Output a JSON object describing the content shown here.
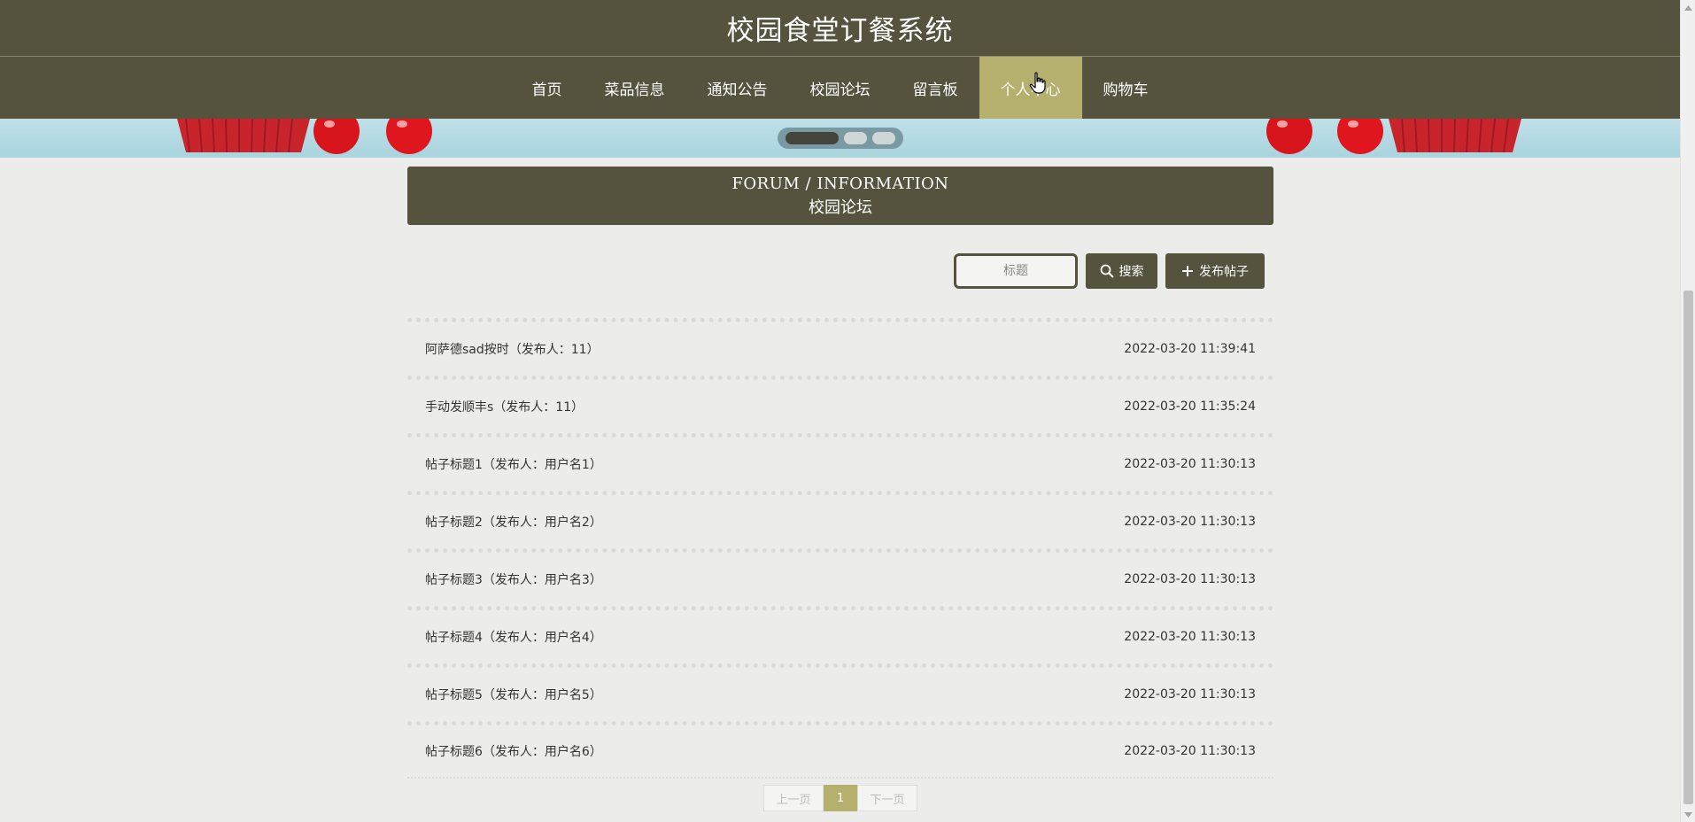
{
  "header": {
    "site_title": "校园食堂订餐系统"
  },
  "nav": {
    "items": [
      {
        "label": "首页"
      },
      {
        "label": "菜品信息"
      },
      {
        "label": "通知公告"
      },
      {
        "label": "校园论坛"
      },
      {
        "label": "留言板"
      },
      {
        "label": "个人中心",
        "active": true
      },
      {
        "label": "购物车"
      }
    ]
  },
  "banner": {
    "slides": 3,
    "active_slide": 1
  },
  "section": {
    "title_en": "FORUM / INFORMATION",
    "title_cn": "校园论坛"
  },
  "toolbar": {
    "search_placeholder": "标题",
    "search_label": "搜索",
    "publish_label": "发布帖子"
  },
  "forum": {
    "rows": [
      {
        "title": "阿萨德sad按时（发布人：11）",
        "time": "2022-03-20 11:39:41"
      },
      {
        "title": "手动发顺丰s（发布人：11）",
        "time": "2022-03-20 11:35:24"
      },
      {
        "title": "帖子标题1（发布人：用户名1）",
        "time": "2022-03-20 11:30:13"
      },
      {
        "title": "帖子标题2（发布人：用户名2）",
        "time": "2022-03-20 11:30:13"
      },
      {
        "title": "帖子标题3（发布人：用户名3）",
        "time": "2022-03-20 11:30:13"
      },
      {
        "title": "帖子标题4（发布人：用户名4）",
        "time": "2022-03-20 11:30:13"
      },
      {
        "title": "帖子标题5（发布人：用户名5）",
        "time": "2022-03-20 11:30:13"
      },
      {
        "title": "帖子标题6（发布人：用户名6）",
        "time": "2022-03-20 11:30:13"
      }
    ]
  },
  "pagination": {
    "prev_label": "上一页",
    "current_page": "1",
    "next_label": "下一页"
  },
  "colors": {
    "primary": "#55533d",
    "accent": "#b5b06d",
    "background": "#ececeb"
  }
}
